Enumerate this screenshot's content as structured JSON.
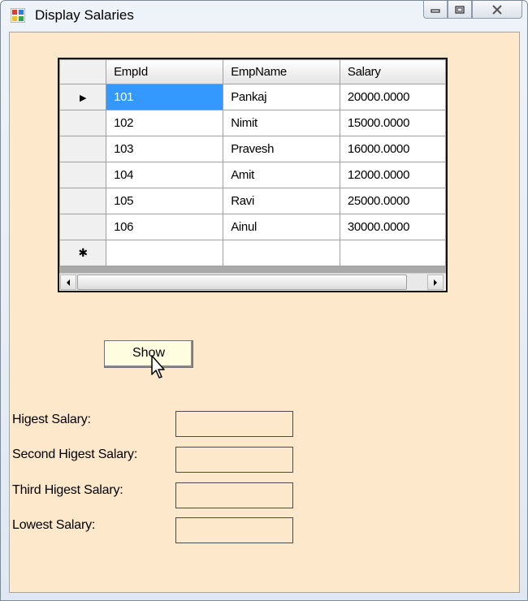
{
  "window": {
    "title": "Display Salaries"
  },
  "grid": {
    "columns": [
      "EmpId",
      "EmpName",
      "Salary"
    ],
    "rows": [
      {
        "id": "101",
        "name": "Pankaj",
        "salary": "20000.0000"
      },
      {
        "id": "102",
        "name": "Nimit",
        "salary": "15000.0000"
      },
      {
        "id": "103",
        "name": "Pravesh",
        "salary": "16000.0000"
      },
      {
        "id": "104",
        "name": "Amit",
        "salary": "12000.0000"
      },
      {
        "id": "105",
        "name": "Ravi",
        "salary": "25000.0000"
      },
      {
        "id": "106",
        "name": "Ainul",
        "salary": "30000.0000"
      }
    ],
    "current_row_marker": "▶",
    "new_row_marker": "✱"
  },
  "show_button": {
    "label": "Show"
  },
  "fields": {
    "highest": {
      "label": "Higest Salary:",
      "value": ""
    },
    "second": {
      "label": "Second Higest Salary:",
      "value": ""
    },
    "third": {
      "label": "Third Higest Salary:",
      "value": ""
    },
    "lowest": {
      "label": "Lowest Salary:",
      "value": ""
    }
  },
  "colors": {
    "client_bg": "#fde8cc",
    "selection": "#3399ff",
    "button_bg": "#fffde0"
  }
}
